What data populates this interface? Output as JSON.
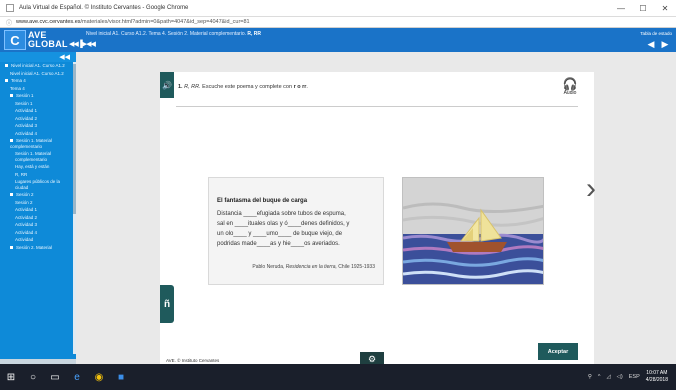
{
  "browser": {
    "window_title": "Aula Virtual de Español. © Instituto Cervantes - Google Chrome",
    "url_host": "www.ave.cvc.cervantes.es",
    "url_path": "/materiales/visor.html?admin=0&path=4047&id_sep=4047&id_cur=81"
  },
  "header": {
    "brand_top": "AVE",
    "brand_bottom": "GLOBAL",
    "brand_arrows": "◀◀▐▶◀◀",
    "breadcrumb": "Nivel inicial A1. Curso A1.2. Tema 4. Sesión 2. Material complementario. ",
    "breadcrumb_bold": "R, RR",
    "tools_label": "Tabla de estado",
    "prev_icon": "◀",
    "next_icon": "▶"
  },
  "sidebar": {
    "collapse_icon": "◀◀",
    "items": [
      {
        "label": "Nivel inicial A1. Curso A1.2",
        "level": 1,
        "bullet": true
      },
      {
        "label": "Nivel inicial A1. Curso A1.2",
        "level": 2,
        "bullet": false
      },
      {
        "label": "Tema 4",
        "level": 1,
        "bullet": true
      },
      {
        "label": "Tema 4",
        "level": 2,
        "bullet": false
      },
      {
        "label": "Sesión 1",
        "level": 2,
        "bullet": true
      },
      {
        "label": "Sesión 1",
        "level": 3,
        "bullet": false
      },
      {
        "label": "Actividad 1",
        "level": 3,
        "bullet": false
      },
      {
        "label": "Actividad 2",
        "level": 3,
        "bullet": false
      },
      {
        "label": "Actividad 3",
        "level": 3,
        "bullet": false
      },
      {
        "label": "Actividad 4",
        "level": 3,
        "bullet": false
      },
      {
        "label": "Sesión 1. Material complementario",
        "level": 2,
        "bullet": true
      },
      {
        "label": "Sesión 1. Material complementario",
        "level": 3,
        "bullet": false
      },
      {
        "label": "Hay, está y están",
        "level": 3,
        "bullet": false
      },
      {
        "label": "R, RR",
        "level": 3,
        "bullet": false
      },
      {
        "label": "Lugares públicos de la ciudad",
        "level": 3,
        "bullet": false
      },
      {
        "label": "Sesión 2",
        "level": 2,
        "bullet": true
      },
      {
        "label": "Sesión 2",
        "level": 3,
        "bullet": false
      },
      {
        "label": "Actividad 1",
        "level": 3,
        "bullet": false
      },
      {
        "label": "Actividad 2",
        "level": 3,
        "bullet": false
      },
      {
        "label": "Actividad 3",
        "level": 3,
        "bullet": false
      },
      {
        "label": "Actividad 4",
        "level": 3,
        "bullet": false
      },
      {
        "label": "Actividad",
        "level": 3,
        "bullet": false
      },
      {
        "label": "Sesión 2. Material",
        "level": 2,
        "bullet": true
      }
    ]
  },
  "activity": {
    "number": "1.",
    "instruction_prefix": "R, RR.",
    "instruction": "Escuche este poema y complete con",
    "instruction_bold": "r o rr",
    "instruction_end": ".",
    "audio_label": "Audio",
    "audio_icon": "headphones-icon",
    "poem_title": "El fantasma del buque de carga",
    "poem_lines": [
      "Distancia ____efugiada sobre tubos de espuma,",
      "sal en ____ituales olas y ó____denes definidos, y",
      "un olo____ y ____umo____ de buque viejo, de",
      "podridas made____as y hie____os averiados."
    ],
    "citation_author": "Pablo Neruda,",
    "citation_work": "Residencia en la tierra,",
    "citation_place": "Chile 1925-1933",
    "next_icon": "chevron-right-icon",
    "tab_letter": "ñ",
    "footer": "AVE. © Instituto Cervantes",
    "accept_label": "Aceptar"
  },
  "taskbar": {
    "time": "10:07 AM",
    "date": "4/28/2018",
    "lang": "ESP"
  },
  "colors": {
    "header_blue": "#1a73c8",
    "sidebar_blue": "#0e8ad8",
    "accent_teal": "#1f5a5c"
  }
}
